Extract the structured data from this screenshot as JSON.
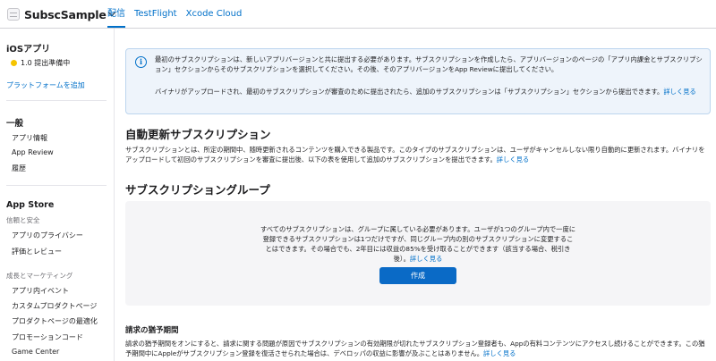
{
  "app": {
    "name": "SubscSample"
  },
  "tabs": [
    {
      "label": "配信"
    },
    {
      "label": "TestFlight"
    },
    {
      "label": "Xcode Cloud"
    }
  ],
  "sidebar": {
    "platform": "iOSアプリ",
    "status": "1.0 提出準備中",
    "add_platform": "プラットフォームを追加",
    "general": {
      "title": "一般",
      "items": [
        "アプリ情報",
        "App Review",
        "履歴"
      ]
    },
    "app_store": {
      "title": "App Store",
      "trust_group": "信頼と安全",
      "trust_items": [
        "アプリのプライバシー",
        "評価とレビュー"
      ],
      "growth_group": "成長とマーケティング",
      "growth_items": [
        "アプリ内イベント",
        "カスタムプロダクトページ",
        "プロダクトページの最適化",
        "プロモーションコード",
        "Game Center"
      ]
    }
  },
  "notice": {
    "line1": "最初のサブスクリプションは、新しいアプリバージョンと共に提出する必要があります。サブスクリプションを作成したら、アプリバージョンのページの「アプリ内課金とサブスクリプション」セクションからそのサブスクリプションを選択してください。その後、そのアプリバージョンをApp Reviewに提出してください。",
    "line2": "バイナリがアップロードされ、最初のサブスクリプションが審査のために提出されたら、追加のサブスクリプションは「サブスクリプション」セクションから提出できます。",
    "learn_more": "詳しく見る"
  },
  "auto_renew": {
    "title": "自動更新サブスクリプション",
    "text": "サブスクリプションとは、所定の期間中、随時更新されるコンテンツを購入できる製品です。このタイプのサブスクリプションは、ユーザがキャンセルしない限り自動的に更新されます。バイナリをアップロードして初回のサブスクリプションを審査に提出後、以下の表を使用して追加のサブスクリプションを提出できます。",
    "learn_more": "詳しく見る"
  },
  "group": {
    "title": "サブスクリプショングループ",
    "text": "すべてのサブスクリプションは、グループに属している必要があります。ユーザが1つのグループ内で一度に登録できるサブスクリプションは1つだけですが、同じグループ内の別のサブスクリプションに変更することはできます。その場合でも、2年目には収益の85%を受け取ることができます（該当する場合、税引き後）。",
    "learn_more": "詳しく見る",
    "create_label": "作成"
  },
  "grace": {
    "title": "請求の猶予期間",
    "text": "請求の猶予期間をオンにすると、請求に関する問題が原因でサブスクリプションの有効期限が切れたサブスクリプション登録者も、Appの有料コンテンツにアクセスし続けることができます。この猶予期間中にAppleがサブスクリプション登録を復活させられた場合は、デベロッパの収益に影響が及ぶことはありません。",
    "learn_more": "詳しく見る"
  },
  "colors": {
    "accent": "#0070c9",
    "button": "#0a6ac6",
    "notice_bg": "#eef4fb",
    "status_dot": "#f5c400"
  }
}
